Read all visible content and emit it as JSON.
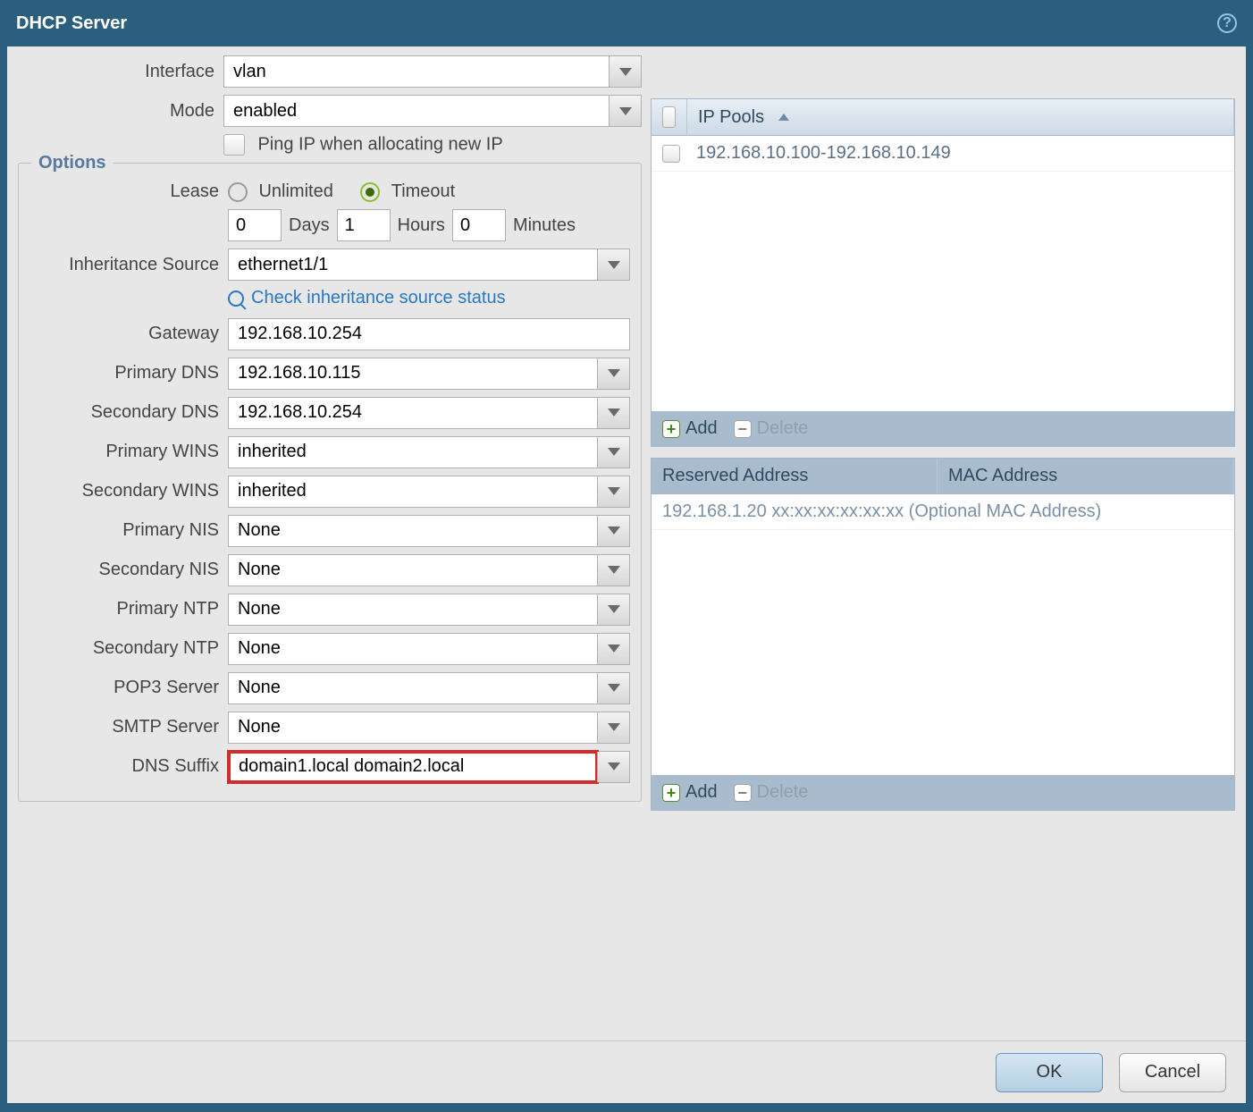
{
  "title": "DHCP Server",
  "interface_label": "Interface",
  "interface_value": "vlan",
  "mode_label": "Mode",
  "mode_value": "enabled",
  "ping_label": "Ping IP when allocating new IP",
  "options_legend": "Options",
  "lease_label": "Lease",
  "lease_unlimited": "Unlimited",
  "lease_timeout": "Timeout",
  "days_value": "0",
  "days_label": "Days",
  "hours_value": "1",
  "hours_label": "Hours",
  "minutes_value": "0",
  "minutes_label": "Minutes",
  "inh_src_label": "Inheritance Source",
  "inh_src_value": "ethernet1/1",
  "check_link": "Check inheritance source status",
  "gateway_label": "Gateway",
  "gateway_value": "192.168.10.254",
  "primary_dns_label": "Primary DNS",
  "primary_dns_value": "192.168.10.115",
  "secondary_dns_label": "Secondary DNS",
  "secondary_dns_value": "192.168.10.254",
  "primary_wins_label": "Primary WINS",
  "primary_wins_value": "inherited",
  "secondary_wins_label": "Secondary WINS",
  "secondary_wins_value": "inherited",
  "primary_nis_label": "Primary NIS",
  "primary_nis_value": "None",
  "secondary_nis_label": "Secondary NIS",
  "secondary_nis_value": "None",
  "primary_ntp_label": "Primary NTP",
  "primary_ntp_value": "None",
  "secondary_ntp_label": "Secondary NTP",
  "secondary_ntp_value": "None",
  "pop3_label": "POP3 Server",
  "pop3_value": "None",
  "smtp_label": "SMTP Server",
  "smtp_value": "None",
  "dns_suffix_label": "DNS Suffix",
  "dns_suffix_value": "domain1.local domain2.local",
  "ip_pools_header": "IP Pools",
  "ip_pools_row": "192.168.10.100-192.168.10.149",
  "reserved_header": "Reserved Address",
  "mac_header": "MAC Address",
  "reserved_placeholder": "192.168.1.20 xx:xx:xx:xx:xx:xx (Optional MAC Address)",
  "add_label": "Add",
  "delete_label": "Delete",
  "ok_label": "OK",
  "cancel_label": "Cancel"
}
